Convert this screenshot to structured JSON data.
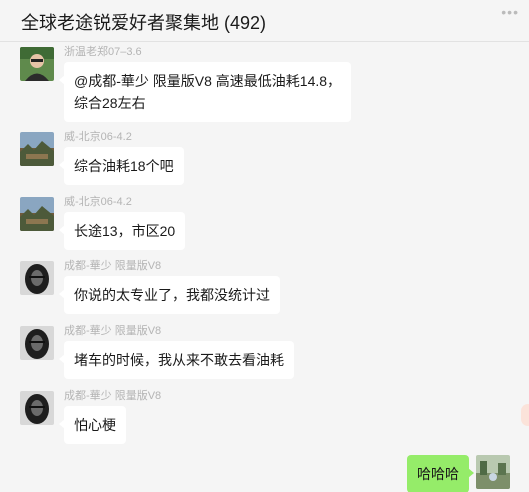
{
  "header": {
    "title": "全球老途锐爱好者聚集地 (492)",
    "more_icon": "ellipsis-icon"
  },
  "messages": [
    {
      "sender": "浙温老郑07–3.6",
      "lines": [
        "@成都-華少 限量版V8 高速最低油耗14.8，",
        "综合28左右"
      ],
      "avatar": "person-photo-avatar"
    },
    {
      "sender": "威-北京06-4.2",
      "lines": [
        "综合油耗18个吧"
      ],
      "avatar": "landscape-avatar"
    },
    {
      "sender": "威-北京06-4.2",
      "lines": [
        "长途13，市区20"
      ],
      "avatar": "landscape-avatar"
    },
    {
      "sender": "成都-華少 限量版V8",
      "lines": [
        "你说的太专业了，我都没统计过"
      ],
      "avatar": "dark-portrait-avatar"
    },
    {
      "sender": "成都-華少 限量版V8",
      "lines": [
        "堵车的时候，我从来不敢去看油耗"
      ],
      "avatar": "dark-portrait-avatar"
    },
    {
      "sender": "成都-華少 限量版V8",
      "lines": [
        "怕心梗"
      ],
      "avatar": "dark-portrait-avatar"
    }
  ],
  "my_message": {
    "text": "哈哈哈",
    "avatar": "scenery-avatar"
  },
  "colors": {
    "background": "#f5f5f5",
    "my_bubble": "#95ec69",
    "other_bubble": "#ffffff",
    "sender_text": "#b4b4b4"
  }
}
